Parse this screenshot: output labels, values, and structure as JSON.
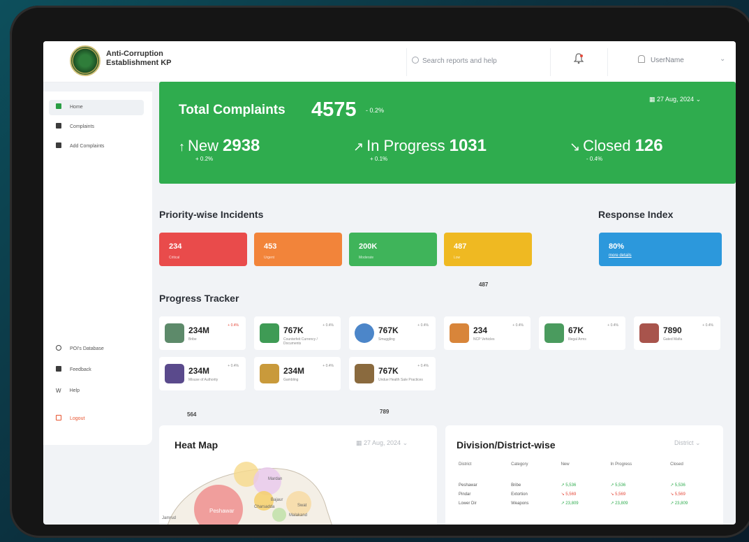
{
  "header": {
    "org_line1": "Anti-Corruption",
    "org_line2": "Establishment KP",
    "search_placeholder": "Search reports and help",
    "user_name": "UserName"
  },
  "sidebar": {
    "items": [
      {
        "label": "Home",
        "icon": "home-icon"
      },
      {
        "label": "Complaints",
        "icon": "complaints-icon"
      },
      {
        "label": "Add Complaints",
        "icon": "add-complaint-icon"
      }
    ],
    "bottom_items": [
      {
        "label": "POI's Database",
        "icon": "eye-icon"
      },
      {
        "label": "Feedback",
        "icon": "feedback-icon"
      },
      {
        "label": "Help",
        "icon": "help-icon"
      }
    ],
    "logout_label": "Logout"
  },
  "summary": {
    "title": "Total Complaints",
    "total": "4575",
    "total_delta": "- 0.2%",
    "date": "27 Aug, 2024",
    "new_label": "New",
    "new_value": "2938",
    "new_delta": "+ 0.2%",
    "progress_label": "In Progress",
    "progress_value": "1031",
    "progress_delta": "+ 0.1%",
    "closed_label": "Closed",
    "closed_value": "126",
    "closed_delta": "- 0.4%"
  },
  "priority": {
    "title": "Priority-wise Incidents",
    "cards": [
      {
        "value": "234",
        "label": "Critical",
        "color": "#e94b4b"
      },
      {
        "value": "453",
        "label": "Urgent",
        "color": "#f2843a"
      },
      {
        "value": "200K",
        "label": "Moderate",
        "color": "#3fb45a"
      },
      {
        "value": "487",
        "label": "Low",
        "color": "#efb922"
      }
    ],
    "below_value": "487"
  },
  "response": {
    "title": "Response Index",
    "value": "80%",
    "link": "more details",
    "color": "#2c98dc"
  },
  "tracker": {
    "title": "Progress Tracker",
    "tiles": [
      {
        "value": "234M",
        "label": "Bribe",
        "delta": "+ 0.4%"
      },
      {
        "value": "767K",
        "label": "Counterfeit Currency / Documents",
        "delta": "+ 0.4%"
      },
      {
        "value": "767K",
        "label": "Smuggling",
        "delta": "+ 0.4%"
      },
      {
        "value": "234",
        "label": "NCP Vehicles",
        "delta": "+ 0.4%"
      },
      {
        "value": "67K",
        "label": "Illegal Arms",
        "delta": "+ 0.4%"
      },
      {
        "value": "7890",
        "label": "Gated Mafia",
        "delta": "+ 0.4%"
      },
      {
        "value": "234M",
        "label": "Misuse of Authority",
        "delta": "+ 0.4%"
      },
      {
        "value": "234M",
        "label": "Gambling",
        "delta": "+ 0.4%"
      },
      {
        "value": "767K",
        "label": "Undue Health Sale Practices",
        "delta": "+ 0.4%"
      }
    ],
    "below_values": [
      "564",
      "789"
    ]
  },
  "heatmap": {
    "title": "Heat Map",
    "date": "27 Aug, 2024",
    "places": [
      "Peshawar",
      "Mardan",
      "Bajaur",
      "Swat",
      "Jamrud",
      "Charsadda",
      "Malakand"
    ]
  },
  "district": {
    "title": "Division/District-wise",
    "filter": "District",
    "columns": [
      "District",
      "Category",
      "New",
      "In Progress",
      "Closed"
    ],
    "rows": [
      {
        "district": "Peshawar",
        "category": "Bribe",
        "new": "↗ 5,536",
        "progress": "↗ 5,536",
        "closed": "↗ 5,536"
      },
      {
        "district": "Pindar",
        "category": "Extortion",
        "new": "↘ 5,569",
        "progress": "↘ 5,569",
        "closed": "↘ 5,569"
      },
      {
        "district": "Lower Dir",
        "category": "Weapons",
        "new": "↗ 23,809",
        "progress": "↗ 23,809",
        "closed": "↗ 23,809"
      }
    ]
  }
}
